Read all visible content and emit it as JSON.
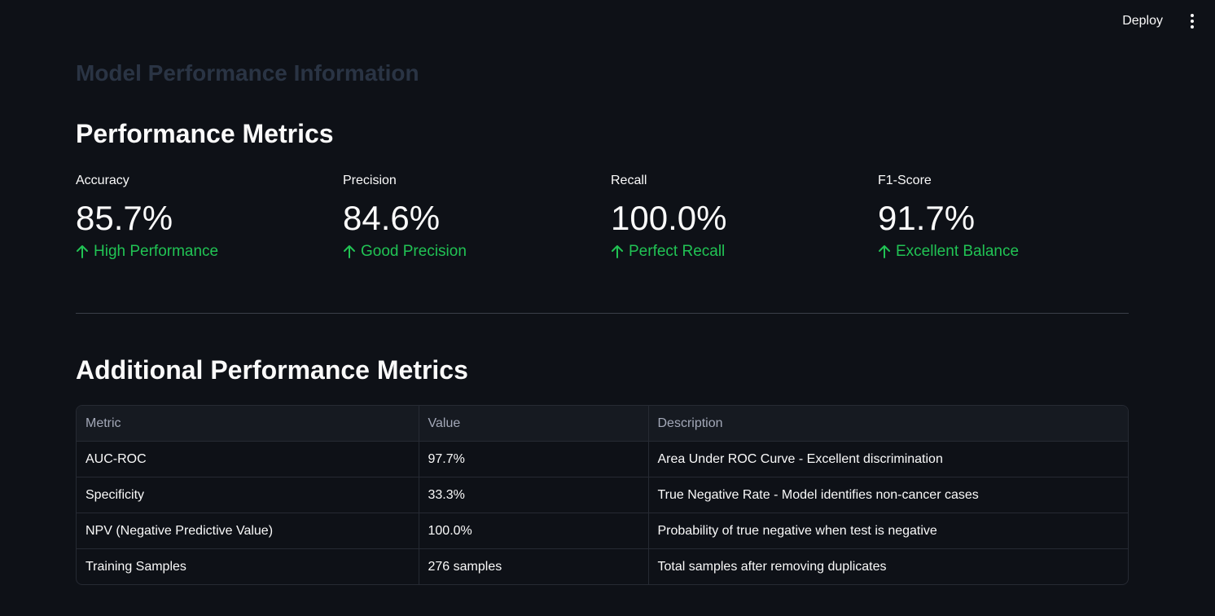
{
  "toolbar": {
    "deploy_label": "Deploy",
    "menu_icon": "kebab-menu-icon"
  },
  "page": {
    "title": "Model Performance Information"
  },
  "performance": {
    "heading": "Performance Metrics",
    "metrics": [
      {
        "label": "Accuracy",
        "value": "85.7%",
        "delta": "High Performance",
        "delta_icon": "arrow-up-icon",
        "delta_color": "#21c354"
      },
      {
        "label": "Precision",
        "value": "84.6%",
        "delta": "Good Precision",
        "delta_icon": "arrow-up-icon",
        "delta_color": "#21c354"
      },
      {
        "label": "Recall",
        "value": "100.0%",
        "delta": "Perfect Recall",
        "delta_icon": "arrow-up-icon",
        "delta_color": "#21c354"
      },
      {
        "label": "F1-Score",
        "value": "91.7%",
        "delta": "Excellent Balance",
        "delta_icon": "arrow-up-icon",
        "delta_color": "#21c354"
      }
    ]
  },
  "additional": {
    "heading": "Additional Performance Metrics",
    "columns": [
      "Metric",
      "Value",
      "Description"
    ],
    "rows": [
      [
        "AUC-ROC",
        "97.7%",
        "Area Under ROC Curve - Excellent discrimination"
      ],
      [
        "Specificity",
        "33.3%",
        "True Negative Rate - Model identifies non-cancer cases"
      ],
      [
        "NPV (Negative Predictive Value)",
        "100.0%",
        "Probability of true negative when test is negative"
      ],
      [
        "Training Samples",
        "276 samples",
        "Total samples after removing duplicates"
      ]
    ]
  },
  "colors": {
    "background": "#0e1117",
    "text": "#fafafa",
    "positive": "#21c354",
    "muted_title": "#2a3444"
  }
}
